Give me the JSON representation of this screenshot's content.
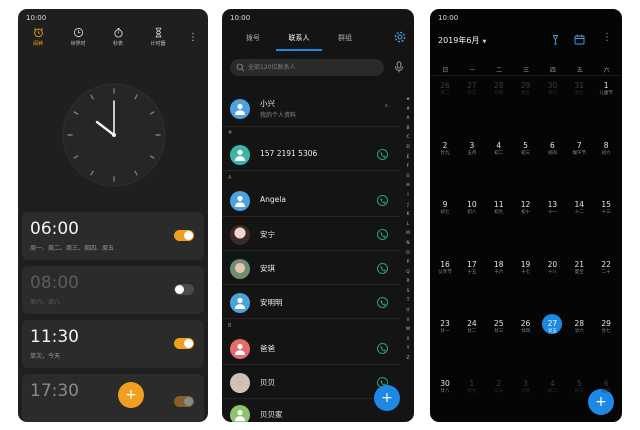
{
  "clock_app": {
    "status_time": "10:00",
    "tabs": [
      {
        "label": "闹钟",
        "icon": "alarm-clock-icon"
      },
      {
        "label": "世界时",
        "icon": "world-clock-icon"
      },
      {
        "label": "秒表",
        "icon": "stopwatch-icon"
      },
      {
        "label": "计时器",
        "icon": "hourglass-icon"
      }
    ],
    "menu_icon": "more-vertical-icon",
    "alarms": [
      {
        "time": "06:00",
        "days": "周一、周二、周三、周四、周五",
        "enabled": true
      },
      {
        "time": "08:00",
        "days": "周六、周八",
        "enabled": false
      },
      {
        "time": "11:30",
        "days": "单次，今天",
        "enabled": true
      },
      {
        "time": "17:30",
        "days": "",
        "enabled": true
      }
    ],
    "fab_label": "+",
    "accent": "#f0a020"
  },
  "contacts_app": {
    "status_time": "10:00",
    "tabs": [
      "拨号",
      "联系人",
      "群组"
    ],
    "active_tab": "联系人",
    "search_placeholder": "全部120位联系人",
    "me": {
      "name": "小兴",
      "subtitle": "我的个人资料"
    },
    "sections": [
      {
        "header": "#",
        "contacts": [
          {
            "name": "157 2191 5306"
          }
        ]
      },
      {
        "header": "A",
        "contacts": [
          {
            "name": "Angela"
          },
          {
            "name": "安宁"
          },
          {
            "name": "安琪"
          },
          {
            "name": "安明明"
          }
        ]
      },
      {
        "header": "B",
        "contacts": [
          {
            "name": "爸爸"
          },
          {
            "name": "贝贝"
          },
          {
            "name": "贝贝家"
          }
        ]
      }
    ],
    "index_letters": [
      "★",
      "#",
      "A",
      "B",
      "C",
      "D",
      "E",
      "F",
      "G",
      "H",
      "I",
      "J",
      "K",
      "L",
      "M",
      "N",
      "O",
      "P",
      "Q",
      "R",
      "S",
      "T",
      "U",
      "V",
      "W",
      "X",
      "Y",
      "Z"
    ],
    "fab_label": "+",
    "accent": "#1e88e5"
  },
  "calendar_app": {
    "status_time": "10:00",
    "month_title": "2019年6月",
    "weekdays": [
      "日",
      "一",
      "二",
      "三",
      "四",
      "五",
      "六"
    ],
    "weeks": [
      [
        {
          "d": "26",
          "l": "廿二",
          "o": true
        },
        {
          "d": "27",
          "l": "廿三",
          "o": true
        },
        {
          "d": "28",
          "l": "廿四",
          "o": true
        },
        {
          "d": "29",
          "l": "廿五",
          "o": true
        },
        {
          "d": "30",
          "l": "廿六",
          "o": true
        },
        {
          "d": "31",
          "l": "廿七",
          "o": true
        },
        {
          "d": "1",
          "l": "儿童节"
        }
      ],
      [
        {
          "d": "2",
          "l": "廿九"
        },
        {
          "d": "3",
          "l": "五月"
        },
        {
          "d": "4",
          "l": "初二"
        },
        {
          "d": "5",
          "l": "初三"
        },
        {
          "d": "6",
          "l": "初四"
        },
        {
          "d": "7",
          "l": "端午节"
        },
        {
          "d": "8",
          "l": "初六"
        }
      ],
      [
        {
          "d": "9",
          "l": "初七"
        },
        {
          "d": "10",
          "l": "初八"
        },
        {
          "d": "11",
          "l": "初九"
        },
        {
          "d": "12",
          "l": "初十"
        },
        {
          "d": "13",
          "l": "十一"
        },
        {
          "d": "14",
          "l": "十二"
        },
        {
          "d": "15",
          "l": "十三"
        }
      ],
      [
        {
          "d": "16",
          "l": "父亲节"
        },
        {
          "d": "17",
          "l": "十五"
        },
        {
          "d": "18",
          "l": "十六"
        },
        {
          "d": "19",
          "l": "十七"
        },
        {
          "d": "20",
          "l": "十八"
        },
        {
          "d": "21",
          "l": "夏至"
        },
        {
          "d": "22",
          "l": "二十"
        }
      ],
      [
        {
          "d": "23",
          "l": "廿一"
        },
        {
          "d": "24",
          "l": "廿二"
        },
        {
          "d": "25",
          "l": "廿三"
        },
        {
          "d": "26",
          "l": "廿四"
        },
        {
          "d": "27",
          "l": "廿五",
          "t": true
        },
        {
          "d": "28",
          "l": "廿六"
        },
        {
          "d": "29",
          "l": "廿七"
        }
      ],
      [
        {
          "d": "30",
          "l": "廿八"
        },
        {
          "d": "1",
          "l": "廿九",
          "o": true
        },
        {
          "d": "2",
          "l": "三十",
          "o": true
        },
        {
          "d": "3",
          "l": "六月",
          "o": true
        },
        {
          "d": "4",
          "l": "初二",
          "o": true
        },
        {
          "d": "5",
          "l": "初三",
          "o": true
        },
        {
          "d": "6",
          "l": "初四",
          "o": true
        }
      ]
    ],
    "icons": [
      "nearby-icon",
      "calendar-today-icon",
      "more-vertical-icon"
    ],
    "fab_label": "+",
    "accent": "#1e88e5"
  }
}
